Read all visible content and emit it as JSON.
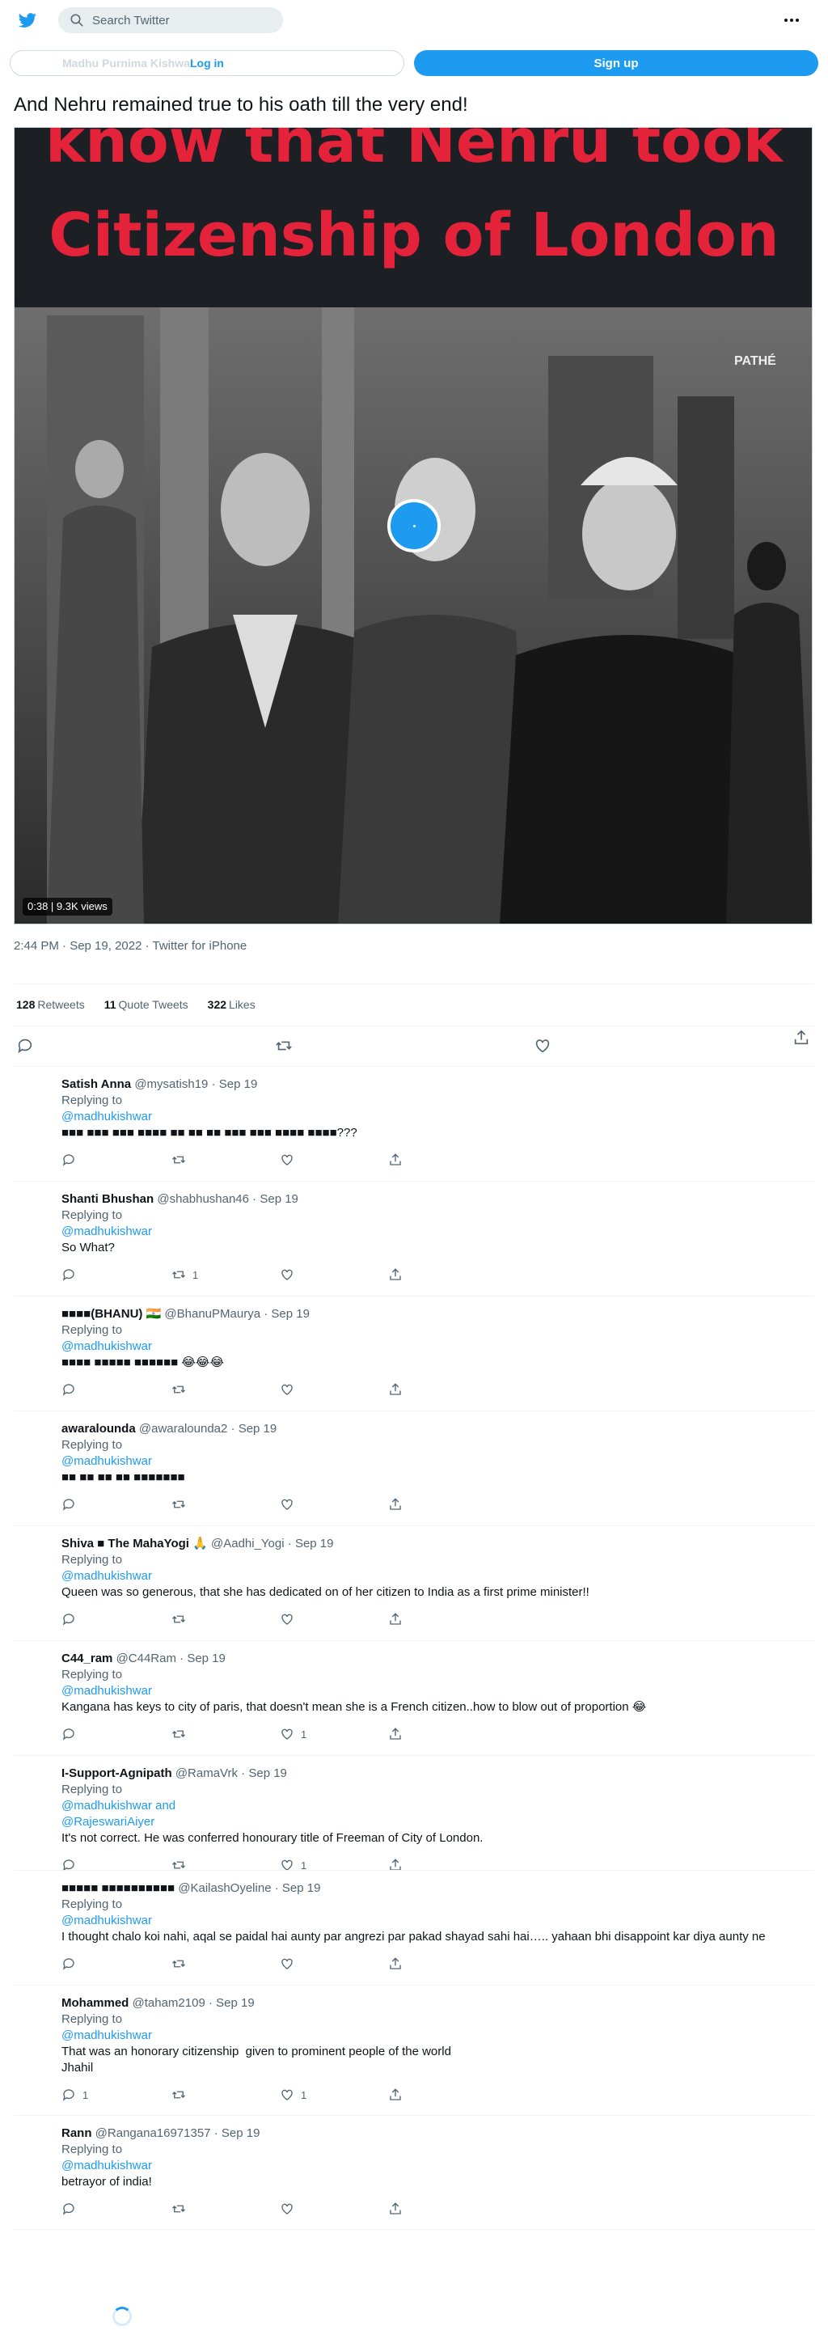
{
  "header": {
    "search_placeholder": "Search Twitter",
    "login_label": "Log in",
    "login_ghost_text": "Madhu Purnima Kishwar",
    "signup_label": "Sign up"
  },
  "tweet": {
    "text": "And Nehru remained true to his oath till the very end!",
    "video_caption_line1": "know that Nehru took",
    "video_caption_line2": "Citizenship of London",
    "video_watermark": "PATHÉ",
    "video_stamp": "0:38 | 9.3K views",
    "timestamp": "2:44 PM · Sep 19, 2022 · Twitter for iPhone",
    "retweets": "128",
    "retweets_label": "Retweets",
    "quotes": "11",
    "quotes_label": "Quote Tweets",
    "likes": "322",
    "likes_label": "Likes"
  },
  "replies": [
    {
      "name": "Satish Anna",
      "handle": "@mysatish19",
      "date": "Sep 19",
      "replying": "Replying to",
      "mentions": "@madhukishwar",
      "text": "■■■ ■■■ ■■■ ■■■■ ■■ ■■ ■■ ■■■ ■■■ ■■■■ ■■■■???",
      "reply_count": "",
      "retweet_count": "",
      "like_count": ""
    },
    {
      "name": "Shanti Bhushan",
      "handle": "@shabhushan46",
      "date": "Sep 19",
      "replying": "Replying to",
      "mentions": "@madhukishwar",
      "text": "So What?",
      "reply_count": "",
      "retweet_count": "1",
      "like_count": ""
    },
    {
      "name": "■■■■(BHANU) 🇮🇳",
      "handle": "@BhanuPMaurya",
      "date": "Sep 19",
      "replying": "Replying to",
      "mentions": "@madhukishwar",
      "text": "■■■■ ■■■■■ ■■■■■■ 😂😂😂",
      "reply_count": "",
      "retweet_count": "",
      "like_count": ""
    },
    {
      "name": "awaralounda",
      "handle": "@awaralounda2",
      "date": "Sep 19",
      "replying": "Replying to",
      "mentions": "@madhukishwar",
      "text": "■■ ■■ ■■ ■■ ■■■■■■■",
      "reply_count": "",
      "retweet_count": "",
      "like_count": ""
    },
    {
      "name": "Shiva ■ The MahaYogi 🙏",
      "handle": "@Aadhi_Yogi",
      "date": "Sep 19",
      "replying": "Replying to",
      "mentions": "@madhukishwar",
      "text": "Queen was so generous, that she has dedicated on of her citizen to India as a first prime minister!!",
      "reply_count": "",
      "retweet_count": "",
      "like_count": ""
    },
    {
      "name": "C44_ram",
      "handle": "@C44Ram",
      "date": "Sep 19",
      "replying": "Replying to",
      "mentions": "@madhukishwar",
      "text": "Kangana has keys to city of paris, that doesn't mean she is a French citizen..how to blow out of proportion 😂",
      "reply_count": "",
      "retweet_count": "",
      "like_count": "1"
    },
    {
      "name": "I-Support-Agnipath",
      "handle": "@RamaVrk",
      "date": "Sep 19",
      "replying": "Replying to",
      "mentions": "@madhukishwar and\n@RajeswariAiyer",
      "text": "It's not correct. He was conferred honourary title of Freeman of City of London.",
      "reply_count": "",
      "retweet_count": "",
      "like_count": "1"
    },
    {
      "name": "■■■■■ ■■■■■■■■■■",
      "handle": "@KailashOyeline",
      "date": "Sep 19",
      "replying": "Replying to",
      "mentions": "@madhukishwar",
      "text": "I thought chalo koi nahi, aqal se paidal hai aunty par angrezi par pakad shayad sahi hai….. yahaan bhi disappoint kar diya aunty ne",
      "reply_count": "",
      "retweet_count": "",
      "like_count": ""
    },
    {
      "name": "Mohammed",
      "handle": "@taham2109",
      "date": "Sep 19",
      "replying": "Replying to",
      "mentions": "@madhukishwar",
      "text": "That was an honorary citizenship  given to prominent people of the world\nJhahil",
      "reply_count": "1",
      "retweet_count": "",
      "like_count": "1"
    },
    {
      "name": "Rann",
      "handle": "@Rangana16971357",
      "date": "Sep 19",
      "replying": "Replying to",
      "mentions": "@madhukishwar",
      "text": "betrayor of india!",
      "reply_count": "",
      "retweet_count": "",
      "like_count": ""
    }
  ],
  "colors": {
    "accent": "#1d9bf0",
    "text": "#0f1419",
    "muted": "#536471",
    "caption_red": "#e4233b"
  },
  "icons": [
    "twitter-bird-icon",
    "search-icon",
    "more-icon",
    "reply-icon",
    "retweet-icon",
    "like-icon",
    "share-icon",
    "play-icon",
    "loading-spinner"
  ]
}
